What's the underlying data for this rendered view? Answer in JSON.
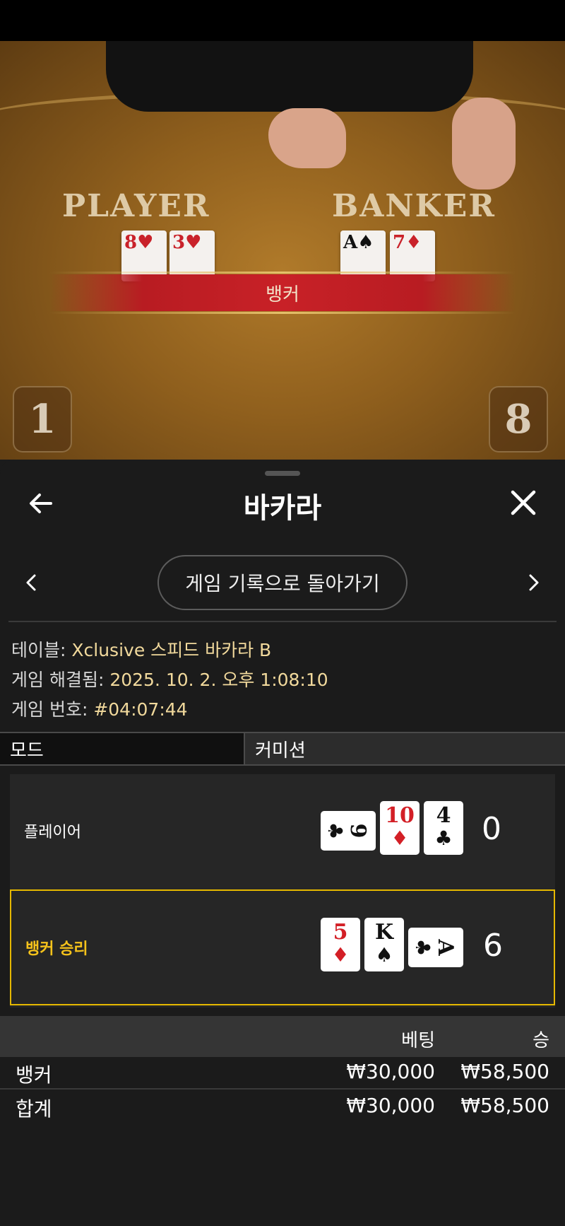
{
  "video": {
    "player_label": "PLAYER",
    "banker_label": "BANKER",
    "player_cards": [
      {
        "rank": "8",
        "suit": "♥"
      },
      {
        "rank": "3",
        "suit": "♥"
      }
    ],
    "banker_cards": [
      {
        "rank": "A",
        "suit": "♠"
      },
      {
        "rank": "7",
        "suit": "♦"
      }
    ],
    "result_banner": "뱅커",
    "left_tile": "1",
    "right_tile": "8"
  },
  "header": {
    "title": "바카라",
    "back_button": "게임 기록으로 돌아가기"
  },
  "info": {
    "table_label": "테이블:",
    "table_value": "Xclusive 스피드 바카라 B",
    "resolved_label": "게임 해결됨:",
    "resolved_value": "2025. 10. 2. 오후 1:08:10",
    "number_label": "게임 번호:",
    "number_value": "#04:07:44"
  },
  "tabs": {
    "mode": "모드",
    "commission": "커미션"
  },
  "results": {
    "player": {
      "label": "플레이어",
      "score": "0",
      "cards": [
        {
          "rank": "9",
          "suit": "♣",
          "color": "black",
          "sideways": true
        },
        {
          "rank": "10",
          "suit": "♦",
          "color": "red"
        },
        {
          "rank": "4",
          "suit": "♣",
          "color": "black"
        }
      ]
    },
    "banker": {
      "label": "뱅커 승리",
      "score": "6",
      "cards": [
        {
          "rank": "5",
          "suit": "♦",
          "color": "red"
        },
        {
          "rank": "K",
          "suit": "♠",
          "color": "black"
        },
        {
          "rank": "A",
          "suit": "♣",
          "color": "black",
          "sideways": true
        }
      ]
    }
  },
  "bets": {
    "headers": {
      "bet": "베팅",
      "win": "승"
    },
    "rows": [
      {
        "name": "뱅커",
        "bet": "₩30,000",
        "win": "₩58,500"
      }
    ],
    "total": {
      "name": "합계",
      "bet": "₩30,000",
      "win": "₩58,500"
    }
  },
  "colors": {
    "accent_gold": "#f5c21b",
    "win_border": "#e5b800",
    "info_value": "#f1d99c"
  }
}
